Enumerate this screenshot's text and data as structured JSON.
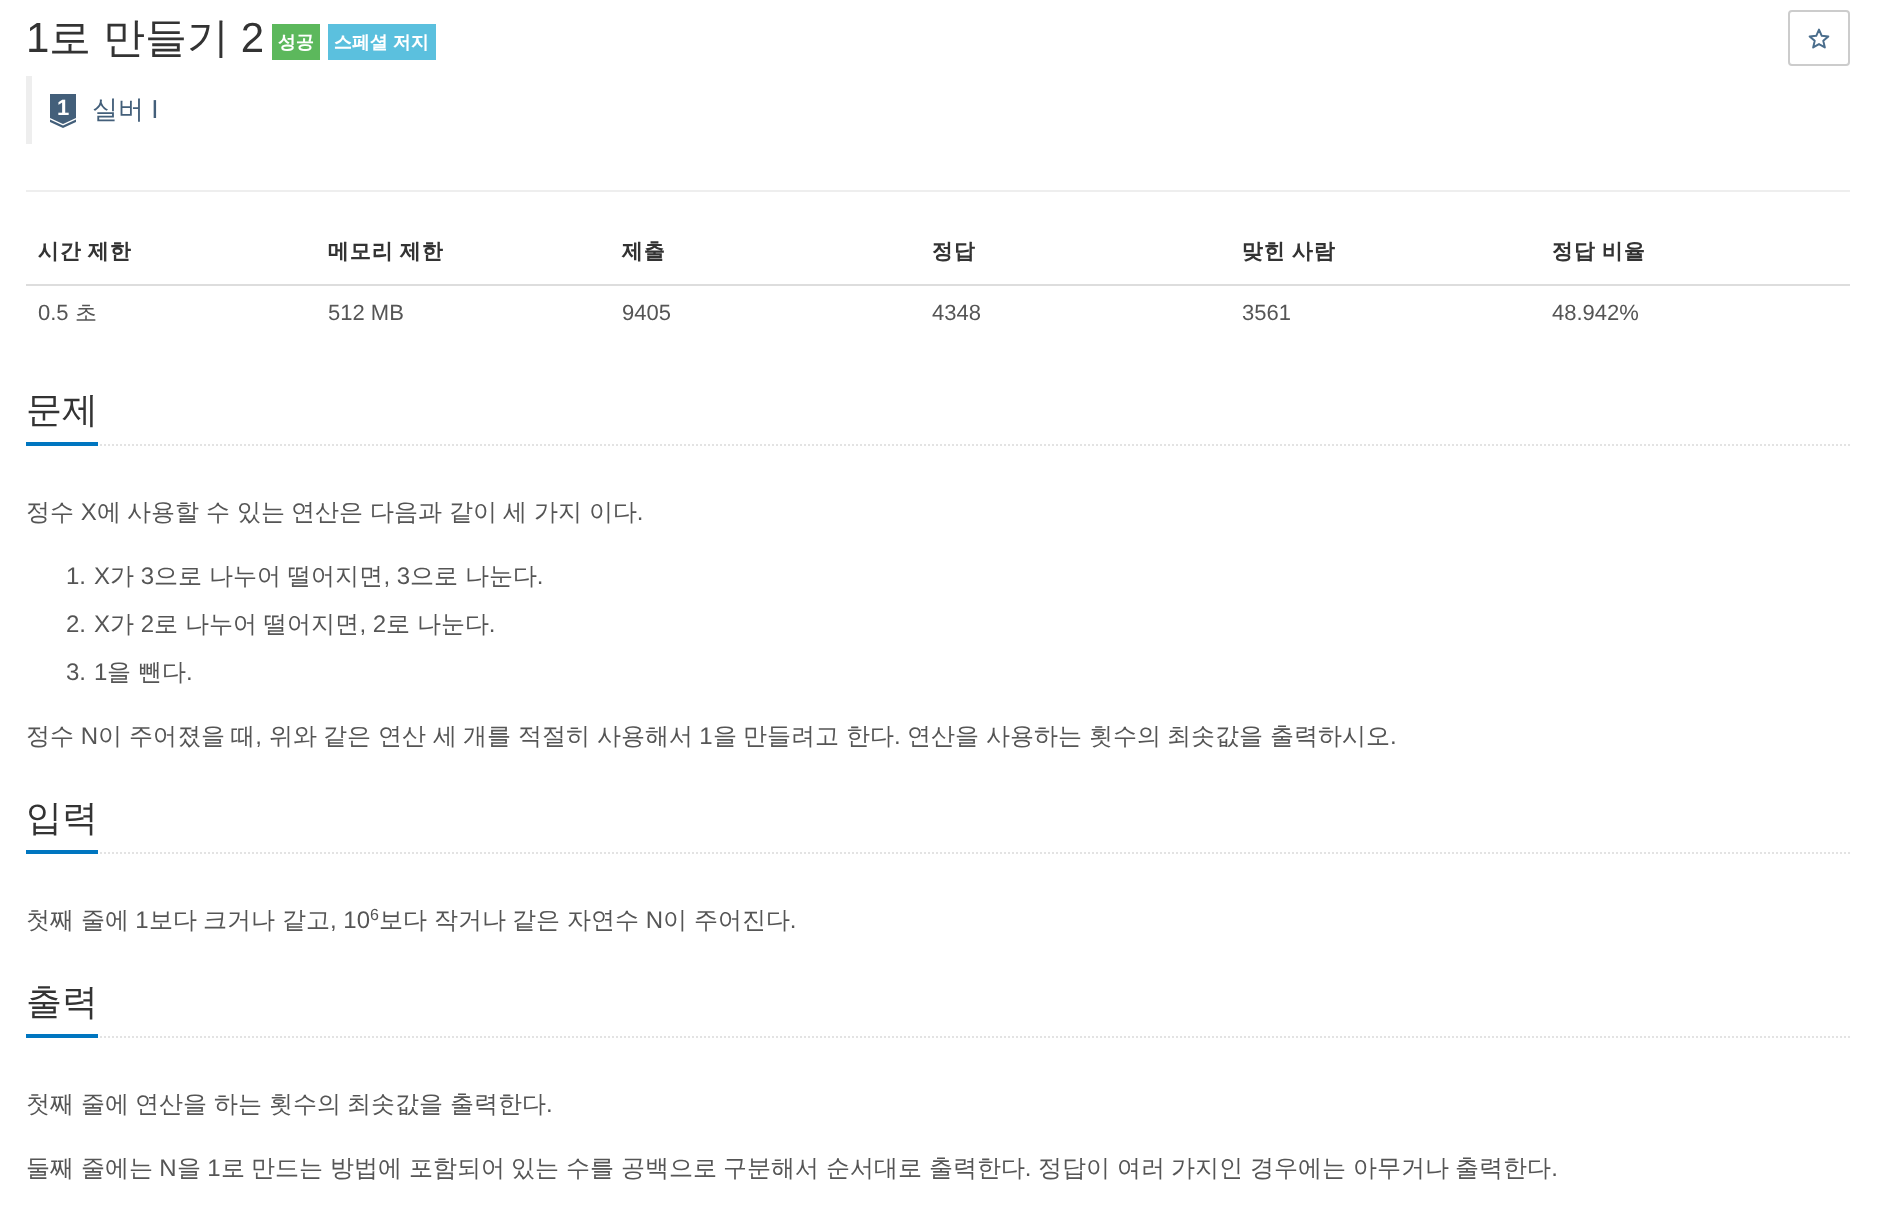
{
  "title": "1로 만들기 2",
  "tags": [
    {
      "kind": "success",
      "text": "성공"
    },
    {
      "kind": "info",
      "text": "스페셜 저지"
    }
  ],
  "tier": {
    "number": "1",
    "name": "실버 I"
  },
  "stats_table": {
    "columns": [
      "시간 제한",
      "메모리 제한",
      "제출",
      "정답",
      "맞힌 사람",
      "정답 비율"
    ],
    "rows": [
      [
        "0.5 초",
        "512 MB",
        "9405",
        "4348",
        "3561",
        "48.942%"
      ]
    ]
  },
  "sections": [
    {
      "heading": "문제",
      "blocks": [
        {
          "kind": "paragraph",
          "text": "정수 X에 사용할 수 있는 연산은 다음과 같이 세 가지 이다."
        },
        {
          "kind": "ordered_list",
          "items": [
            {
              "number": "1.",
              "text": "X가 3으로 나누어 떨어지면, 3으로 나눈다."
            },
            {
              "number": "2.",
              "text": "X가 2로 나누어 떨어지면, 2로 나눈다."
            },
            {
              "number": "3.",
              "text": "1을 뺀다."
            }
          ]
        },
        {
          "kind": "paragraph",
          "text": "정수 N이 주어졌을 때, 위와 같은 연산 세 개를 적절히 사용해서 1을 만들려고 한다. 연산을 사용하는 횟수의 최솟값을 출력하시오."
        }
      ]
    },
    {
      "heading": "입력",
      "blocks": [
        {
          "kind": "paragraph",
          "text": "첫째 줄에 1보다 크거나 같고, 10$^{6}$보다 작거나 같은 자연수 N이 주어진다."
        }
      ]
    },
    {
      "heading": "출력",
      "blocks": [
        {
          "kind": "paragraph",
          "text": "첫째 줄에 연산을 하는 횟수의 최솟값을 출력한다."
        },
        {
          "kind": "paragraph",
          "text": "둘째 줄에는 N을 1로 만드는 방법에 포함되어 있는 수를 공백으로 구분해서 순서대로 출력한다. 정답이 여러 가지인 경우에는 아무거나 출력한다."
        }
      ]
    }
  ]
}
